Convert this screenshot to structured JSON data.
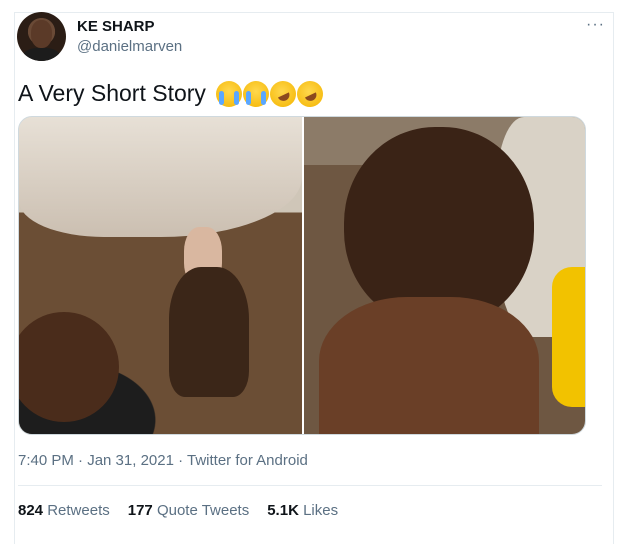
{
  "tweet": {
    "author_name": "KE SHARP",
    "author_handle": "@danielmarven",
    "more_label": "···",
    "text": "A Very Short Story",
    "emojis": [
      "loudly-crying-face",
      "loudly-crying-face",
      "rolling-on-floor-laughing",
      "rolling-on-floor-laughing"
    ],
    "timestamp": "7:40 PM · Jan 31, 2021 · Twitter for Android",
    "stats": {
      "retweets_count": "824",
      "retweets_label": "Retweets",
      "quotes_count": "177",
      "quotes_label": "Quote Tweets",
      "likes_count": "5.1K",
      "likes_label": "Likes"
    }
  },
  "colors": {
    "text": "#0f1419",
    "secondary": "#5b7083",
    "border": "#e6ecf0"
  }
}
